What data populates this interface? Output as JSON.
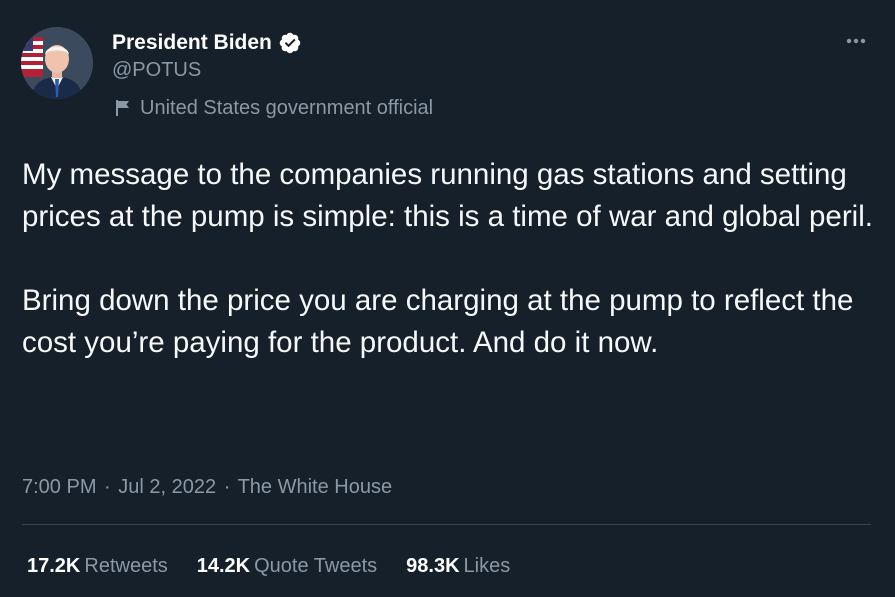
{
  "author": {
    "display_name": "President Biden",
    "handle": "@POTUS",
    "label": "United States government official",
    "avatar_icon": "portrait-avatar",
    "verified_icon": "verified-badge-icon"
  },
  "tweet": {
    "text": "My message to the companies running gas stations and setting prices at the pump is simple: this is a time of war and global peril.\n\nBring down the price you are charging at the pump to reflect the cost you’re paying for the product. And do it now."
  },
  "meta": {
    "time": "7:00 PM",
    "separator": "·",
    "date": "Jul 2, 2022",
    "source": "The White House"
  },
  "stats": {
    "retweets": {
      "count": "17.2K",
      "label": "Retweets"
    },
    "quotes": {
      "count": "14.2K",
      "label": "Quote Tweets"
    },
    "likes": {
      "count": "98.3K",
      "label": "Likes"
    }
  },
  "colors": {
    "background": "#15202b",
    "secondary_text": "#8b98a5",
    "divider": "#38444d",
    "verified_badge": "#ffffff"
  }
}
